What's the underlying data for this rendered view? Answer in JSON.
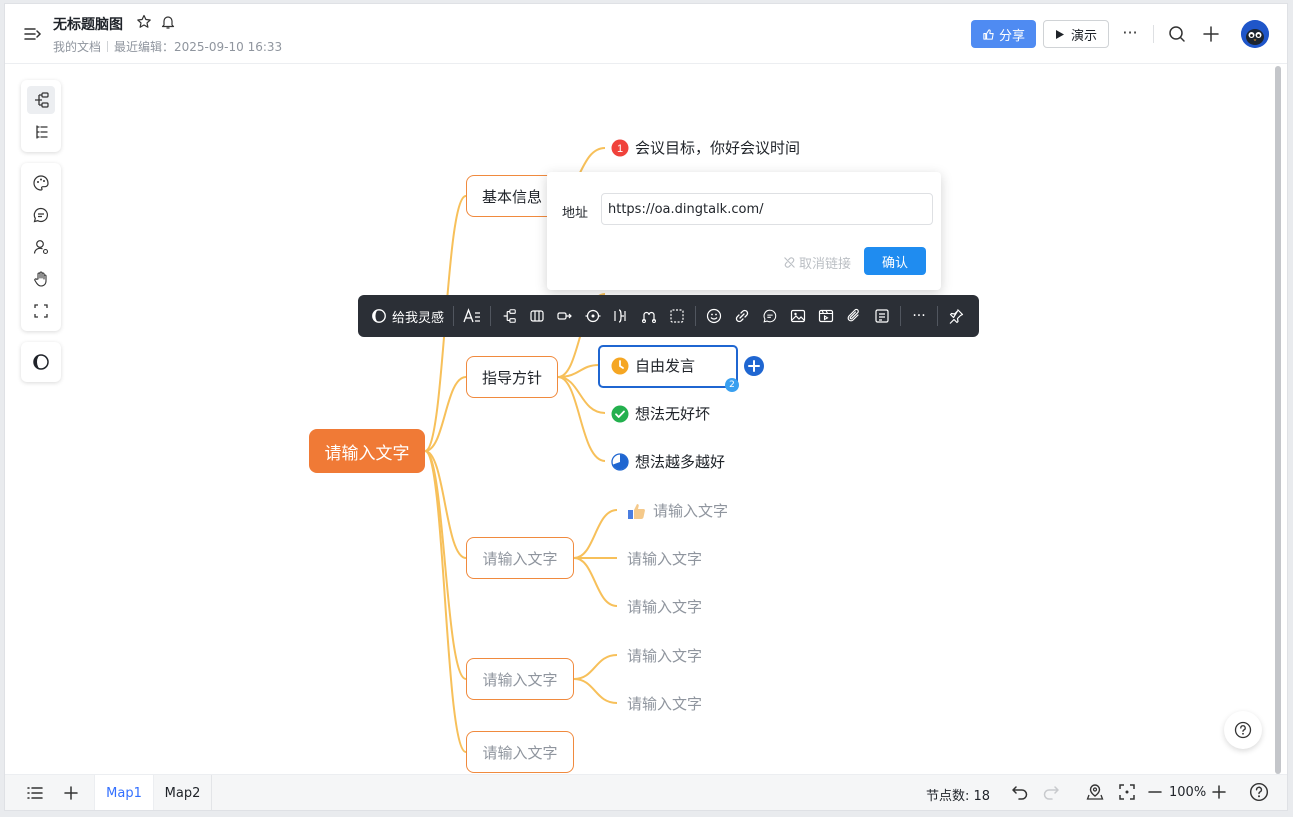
{
  "header": {
    "title": "无标题脑图",
    "breadcrumb": "我的文档",
    "last_edit": "最近编辑：2025-09-10 16:33",
    "share_label": "分享",
    "present_label": "演示",
    "more_label": "···"
  },
  "mindmap": {
    "root": "请输入文字",
    "branches": [
      {
        "label": "基本信息",
        "children": [
          "会议目标，你好会议时间"
        ]
      },
      {
        "label": "指导方针",
        "children": [
          "自由发言",
          "想法无好坏",
          "想法越多越好"
        ]
      },
      {
        "label": "请输入文字",
        "children": [
          "请输入文字",
          "请输入文字",
          "请输入文字"
        ]
      },
      {
        "label": "请输入文字",
        "children": [
          "请输入文字",
          "请输入文字"
        ]
      },
      {
        "label": "请输入文字",
        "children": []
      }
    ],
    "selected_badge": "2"
  },
  "link_popup": {
    "label": "地址",
    "url": "https://oa.dingtalk.com/",
    "unlink_label": "取消链接",
    "confirm_label": "确认"
  },
  "format_toolbar": {
    "inspire_label": "给我灵感",
    "more_label": "···"
  },
  "bottom_bar": {
    "tabs": [
      "Map1",
      "Map2"
    ],
    "node_count": "节点数: 18",
    "zoom": "100%"
  },
  "colors": {
    "root": "#f07a36",
    "branch_border": "#f08a3e",
    "line": "#f7c05a",
    "accent": "#3370ff"
  }
}
